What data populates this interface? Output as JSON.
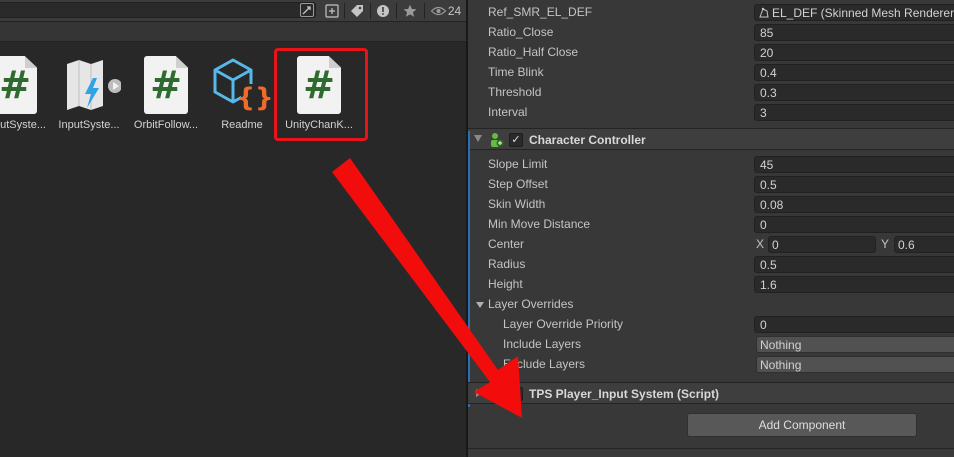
{
  "project": {
    "toolbar": {
      "search_value": "",
      "hidden_count": "24"
    },
    "assets": [
      {
        "label": "InputSyste...",
        "type": "script"
      },
      {
        "label": "InputSyste...",
        "type": "input-actions"
      },
      {
        "label": "OrbitFollow...",
        "type": "script"
      },
      {
        "label": "Readme",
        "type": "readme"
      },
      {
        "label": "UnityChanK...",
        "type": "script",
        "highlighted": true
      }
    ]
  },
  "inspector": {
    "eye_blink_props": [
      {
        "label": "Ref_SMR_EL_DEF",
        "value": "EL_DEF (Skinned Mesh Renderer)"
      },
      {
        "label": "Ratio_Close",
        "value": "85"
      },
      {
        "label": "Ratio_Half Close",
        "value": "20"
      },
      {
        "label": "Time Blink",
        "value": "0.4"
      },
      {
        "label": "Threshold",
        "value": "0.3"
      },
      {
        "label": "Interval",
        "value": "3"
      }
    ],
    "character_controller": {
      "title": "Character Controller",
      "checked": "✓",
      "props": [
        {
          "label": "Slope Limit",
          "value": "45"
        },
        {
          "label": "Step Offset",
          "value": "0.5"
        },
        {
          "label": "Skin Width",
          "value": "0.08"
        },
        {
          "label": "Min Move Distance",
          "value": "0"
        }
      ],
      "center": {
        "label": "Center",
        "x_label": "X",
        "x": "0",
        "y_label": "Y",
        "y": "0.6"
      },
      "props2": [
        {
          "label": "Radius",
          "value": "0.5"
        },
        {
          "label": "Height",
          "value": "1.6"
        }
      ],
      "layer_overrides": {
        "label": "Layer Overrides",
        "priority_label": "Layer Override Priority",
        "priority_value": "0",
        "include_label": "Include Layers",
        "include_value": "Nothing",
        "exclude_label": "Exclude Layers",
        "exclude_value": "Nothing"
      }
    },
    "tps_component": {
      "title": "TPS Player_Input System (Script)"
    },
    "add_component_label": "Add Component"
  },
  "colors": {
    "highlight": "#e8141a",
    "script_hash": "#2f6b2f",
    "accent": "#2d6fb5"
  }
}
